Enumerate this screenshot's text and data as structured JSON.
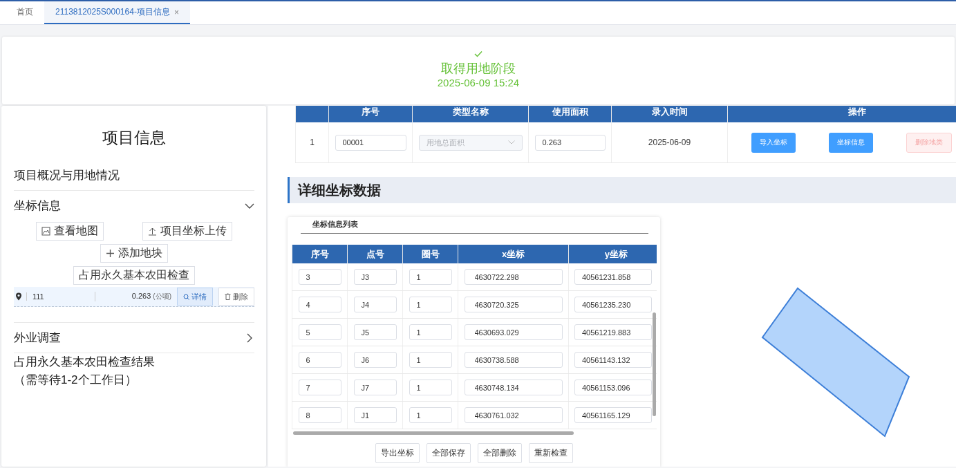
{
  "tabs": [
    {
      "label": "首页",
      "selected": false,
      "closable": false
    },
    {
      "label": "2113812025S000164-项目信息",
      "selected": true,
      "closable": true
    }
  ],
  "tab_close_glyph": "×",
  "stage": {
    "label": "取得用地阶段",
    "time": "2025-06-09 15:24",
    "completed": true
  },
  "sidebar": {
    "title": "项目信息",
    "overview": "项目概况与用地情况",
    "coords_section": {
      "label": "坐标信息",
      "expanded": true,
      "buttons": [
        "查看地图",
        "项目坐标上传",
        "添加地块",
        "占用永久基本农田检查"
      ],
      "plots": [
        {
          "name": "111",
          "area": "0.263",
          "unit": "(公顷)",
          "detail": "详情",
          "delete": "删除"
        }
      ]
    },
    "field_survey": {
      "label": "外业调查",
      "expanded": false
    },
    "check_result": [
      "占用永久基本农田检查结果",
      "（需等待1-2个工作日）"
    ]
  },
  "land_table": {
    "columns": [
      "序号",
      "类型名称",
      "使用面积",
      "录入时间",
      "操作"
    ],
    "rows": [
      {
        "index": "1",
        "code": "00001",
        "type": "用地总面积",
        "type_disabled": true,
        "area": "0.263",
        "date": "2025-06-09",
        "actions": [
          {
            "label": "导入坐标",
            "disabled": false
          },
          {
            "label": "坐标信息",
            "disabled": false
          },
          {
            "label": "删除地类",
            "disabled": true
          }
        ]
      }
    ]
  },
  "section_title": "详细坐标数据",
  "coords": {
    "title": "坐标信息列表",
    "columns": [
      "序号",
      "点号",
      "圈号",
      "x坐标",
      "y坐标"
    ],
    "rows": [
      [
        "3",
        "J3",
        "1",
        "4630722.298",
        "40561231.858"
      ],
      [
        "4",
        "J4",
        "1",
        "4630720.325",
        "40561235.230"
      ],
      [
        "5",
        "J5",
        "1",
        "4630693.029",
        "40561219.883"
      ],
      [
        "6",
        "J6",
        "1",
        "4630738.588",
        "40561143.132"
      ],
      [
        "7",
        "J7",
        "1",
        "4630748.134",
        "40561153.096"
      ],
      [
        "8",
        "J1",
        "1",
        "4630761.032",
        "40561165.129"
      ]
    ],
    "buttons": [
      "导出坐标",
      "全部保存",
      "全部删除",
      "重新检查"
    ]
  }
}
